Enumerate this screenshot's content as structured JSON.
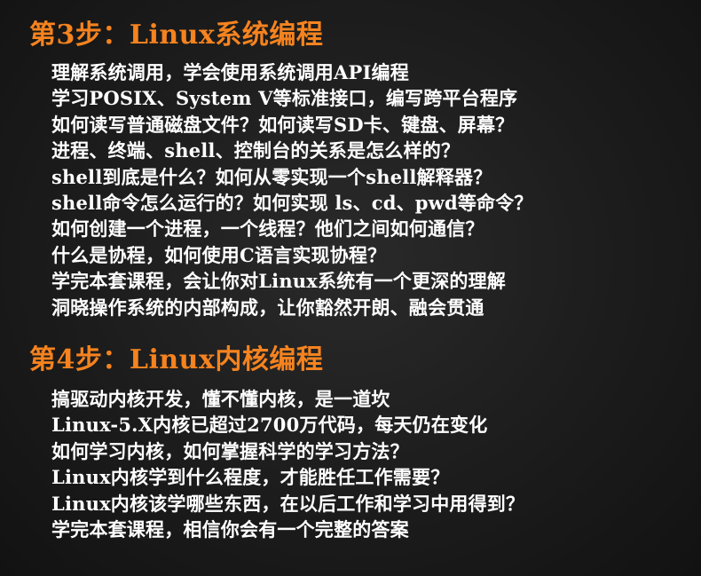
{
  "step3": {
    "title": "第3步：Linux系统编程",
    "lines": [
      "理解系统调用，学会使用系统调用API编程",
      "学习POSIX、System V等标准接口，编写跨平台程序",
      "如何读写普通磁盘文件？如何读写SD卡、键盘、屏幕？",
      "进程、终端、shell、控制台的关系是怎么样的？",
      "shell到底是什么？如何从零实现一个shell解释器？",
      "shell命令怎么运行的？如何实现 ls、cd、pwd等命令？",
      "如何创建一个进程，一个线程？他们之间如何通信？",
      "什么是协程，如何使用C语言实现协程？",
      "学完本套课程，会让你对Linux系统有一个更深的理解",
      "洞晓操作系统的内部构成，让你豁然开朗、融会贯通"
    ]
  },
  "step4": {
    "title": "第4步：Linux内核编程",
    "lines": [
      "搞驱动内核开发，懂不懂内核，是一道坎",
      "Linux-5.X内核已超过2700万代码，每天仍在变化",
      "如何学习内核，如何掌握科学的学习方法？",
      "Linux内核学到什么程度，才能胜任工作需要？",
      "Linux内核该学哪些东西，在以后工作和学习中用得到？",
      "学完本套课程，相信你会有一个完整的答案"
    ]
  },
  "colors": {
    "heading": "#f5831f",
    "text": "#ffffff",
    "background": "#1f1f1f"
  }
}
